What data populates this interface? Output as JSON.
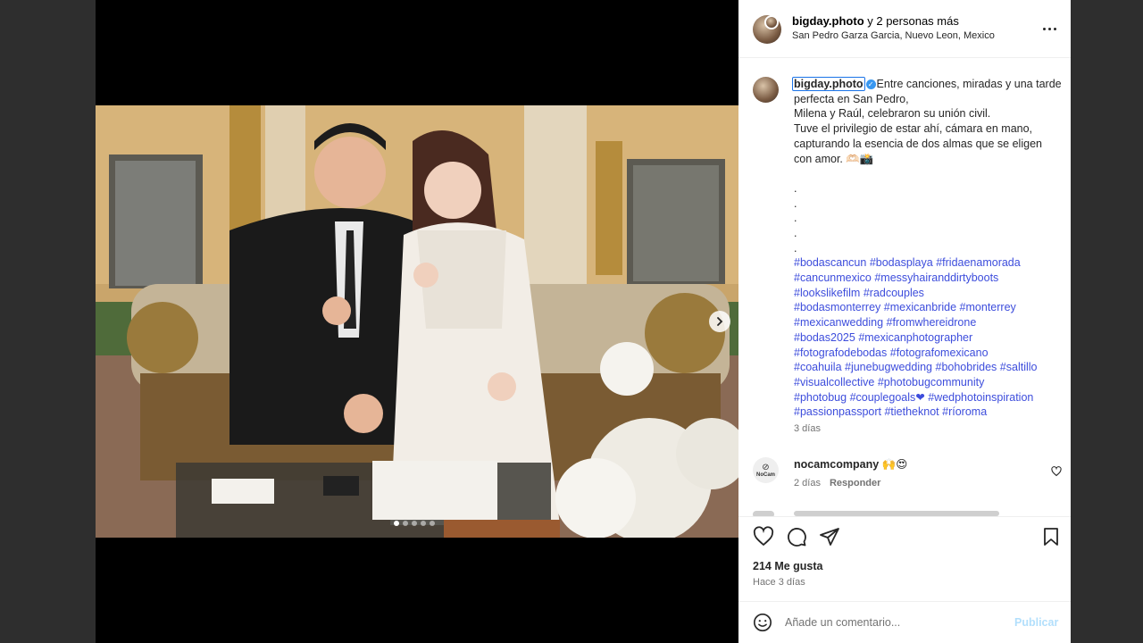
{
  "header": {
    "username": "bigday.photo",
    "collab_text": " y 2 personas más",
    "location": "San Pedro Garza Garcia, Nuevo Leon, Mexico"
  },
  "caption": {
    "username": "bigday.photo",
    "line1": "Entre canciones, miradas y una tarde perfecta en San Pedro,",
    "line2": "Milena y Raúl, celebraron su unión civil.",
    "line3": "Tuve el privilegio de estar ahí, cámara en mano, capturando la esencia de dos almas que se eligen con amor. 🫶🏻📸",
    "dots": [
      ".",
      ".",
      ".",
      ".",
      "."
    ],
    "hashtags": [
      "#bodascancun",
      "#bodasplaya",
      "#fridaenamorada",
      "#cancunmexico",
      "#messyhairanddirtyboots",
      "#lookslikefilm",
      "#radcouples",
      "#bodasmonterrey",
      "#mexicanbride",
      "#monterrey",
      "#mexicanwedding",
      "#fromwhereidrone",
      "#bodas2025",
      "#mexicanphotographer",
      "#fotografodebodas",
      "#fotografomexicano",
      "#coahuila",
      "#junebugwedding",
      "#bohobrides",
      "#saltillo",
      "#visualcollective",
      "#photobugcommunity",
      "#photobug",
      "#couplegoals❤",
      "#wedphotoinspiration",
      "#passionpassport",
      "#tietheknot",
      "#ríoroma"
    ],
    "time": "3 días"
  },
  "comment": {
    "username": "nocamcompany",
    "text": " 🙌😍",
    "avatar_text": "NoCam",
    "time": "2 días",
    "reply_label": "Responder"
  },
  "stats": {
    "likes": "214 Me gusta",
    "ago": "Hace 3 días"
  },
  "composer": {
    "placeholder": "Añade un comentario...",
    "publish_label": "Publicar"
  },
  "carousel": {
    "slide_count": 5,
    "active_index": 0
  },
  "colors": {
    "link": "#3d4ddc",
    "verified": "#3897f0",
    "publish_disabled": "#b2dffc"
  }
}
